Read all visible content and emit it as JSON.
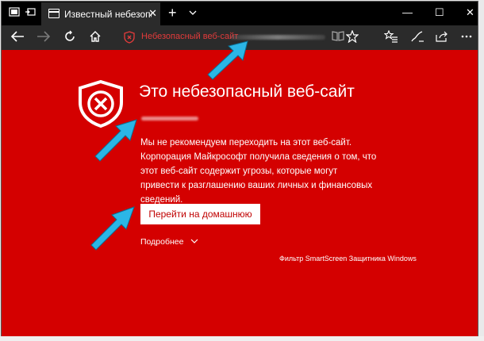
{
  "tab": {
    "title": "Известный небезопасн",
    "close": "✕"
  },
  "tabbar": {
    "new_tab": "+",
    "tab_list": "⌄"
  },
  "window_controls": {
    "minimize": "—",
    "maximize": "☐",
    "close": "✕"
  },
  "address_bar": {
    "text": "Небезопасный веб-сайт"
  },
  "page": {
    "headline": "Это небезопасный веб-сайт",
    "body": "Мы не рекомендуем переходить на этот веб-сайт. Корпорация Майкрософт получила сведения о том, что этот веб-сайт содержит угрозы, которые могут привести к разглашению ваших личных и финансовых сведений.",
    "home_button": "Перейти на домашнюю",
    "more_link": "Подробнее",
    "footer": "Фильтр SmartScreen Защитника Windows"
  },
  "colors": {
    "page_background": "#d40000",
    "chrome_dark": "#2b2b2b",
    "tab_bar": "#000000",
    "annotation_arrow": "#2bb6e6"
  },
  "icons": {
    "toolbar": [
      "back-icon",
      "forward-icon",
      "refresh-icon",
      "home-icon",
      "favorite-star-icon",
      "favorites-hub-icon",
      "pen-icon",
      "share-icon",
      "more-icon"
    ],
    "warning": "shield-x-icon"
  }
}
